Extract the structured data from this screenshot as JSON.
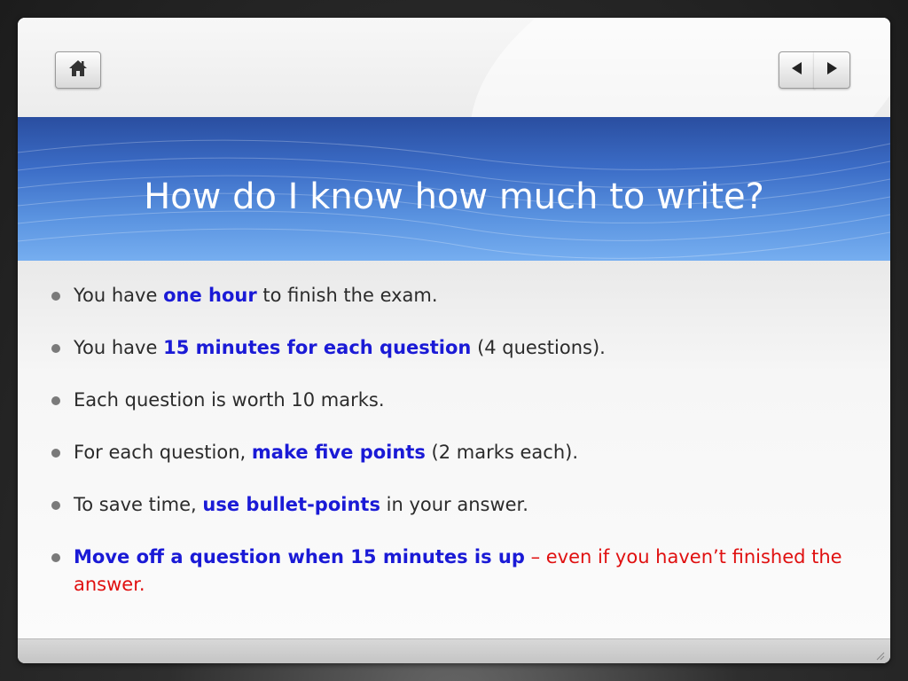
{
  "navigation": {
    "home_icon": "home-icon",
    "prev_icon": "left-triangle-icon",
    "next_icon": "right-triangle-icon"
  },
  "slide": {
    "title": "How do I know how much to write?",
    "bullets": [
      {
        "parts": [
          {
            "text": "You have ",
            "style": "normal"
          },
          {
            "text": "one hour",
            "style": "emphasis"
          },
          {
            "text": " to finish the exam.",
            "style": "normal"
          }
        ]
      },
      {
        "parts": [
          {
            "text": "You have ",
            "style": "normal"
          },
          {
            "text": "15 minutes for each question",
            "style": "emphasis"
          },
          {
            "text": " (4 questions).",
            "style": "normal"
          }
        ]
      },
      {
        "parts": [
          {
            "text": "Each question is worth 10 marks.",
            "style": "normal"
          }
        ]
      },
      {
        "parts": [
          {
            "text": "For each question, ",
            "style": "normal"
          },
          {
            "text": "make five points",
            "style": "emphasis"
          },
          {
            "text": " (2 marks each).",
            "style": "normal"
          }
        ]
      },
      {
        "parts": [
          {
            "text": "To save time, ",
            "style": "normal"
          },
          {
            "text": "use bullet-points",
            "style": "emphasis"
          },
          {
            "text": " in your answer.",
            "style": "normal"
          }
        ]
      },
      {
        "parts": [
          {
            "text": "Move off a question when 15 minutes is up",
            "style": "emphasis"
          },
          {
            "text": " – even if you haven’t finished the answer.",
            "style": "warning"
          }
        ]
      }
    ]
  },
  "colors": {
    "emphasis": "#1a1ad6",
    "warning": "#e01010",
    "body_text": "#2b2b2b",
    "title_band": "#3b6cc6",
    "title_text": "#ffffff"
  }
}
